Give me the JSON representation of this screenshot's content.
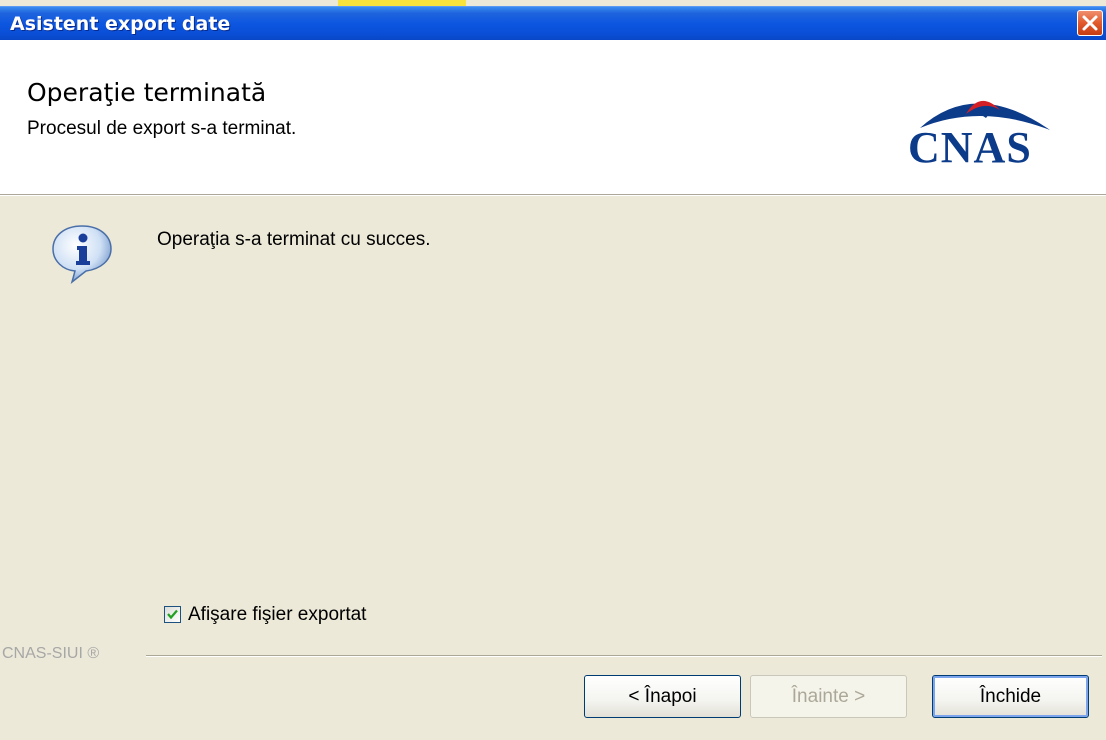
{
  "window": {
    "title": "Asistent export date"
  },
  "header": {
    "title": "Operaţie terminată",
    "subtitle": "Procesul de export s-a terminat.",
    "logo_text": "CNAS"
  },
  "body": {
    "message": "Operaţia s-a terminat cu succes.",
    "show_file_checkbox": {
      "label": "Afişare fişier exportat",
      "checked": true
    }
  },
  "footer": {
    "brand": "CNAS-SIUI ®",
    "buttons": {
      "back": "< Înapoi",
      "next": "Înainte >",
      "close": "Închide"
    }
  },
  "colors": {
    "titlebar": "#0a4ed5",
    "dialog_bg": "#ece9d8",
    "logo_blue": "#0c3b8a",
    "logo_red": "#d31f26",
    "close_button": "#e05a2c"
  },
  "icons": {
    "close": "close-icon",
    "info": "info-icon",
    "check": "checkmark-icon",
    "logo": "cnas-logo"
  }
}
